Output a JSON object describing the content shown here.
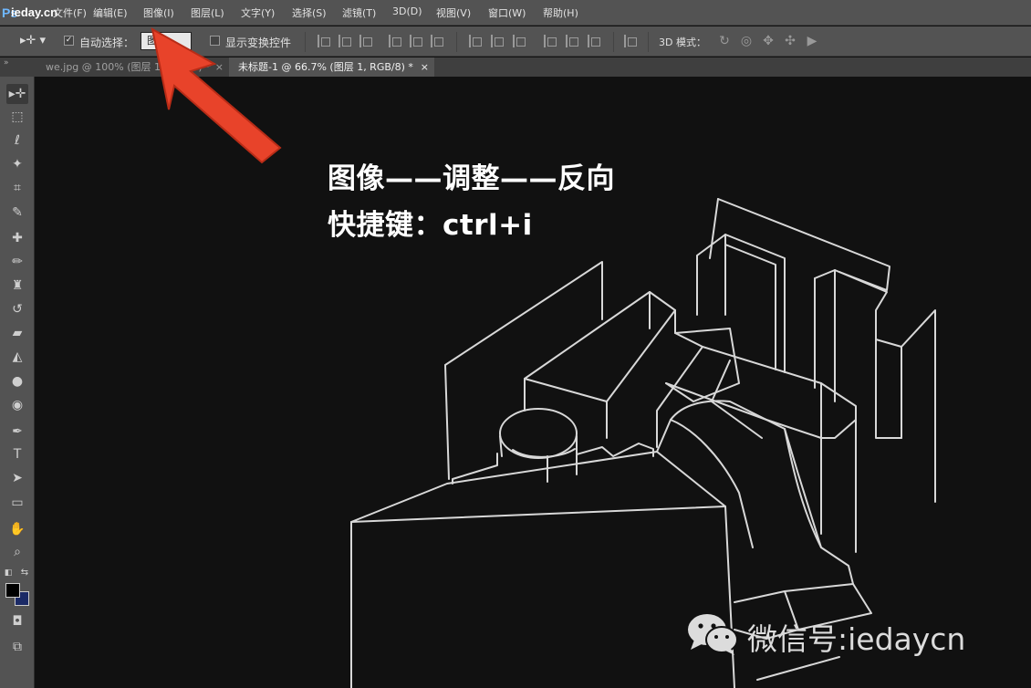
{
  "app": {
    "logo_ps": "Ps",
    "logo_site": "ieday.cn"
  },
  "menu": {
    "items": [
      "文件(F)",
      "编辑(E)",
      "图像(I)",
      "图层(L)",
      "文字(Y)",
      "选择(S)",
      "滤镜(T)",
      "3D(D)",
      "视图(V)",
      "窗口(W)",
      "帮助(H)"
    ]
  },
  "options": {
    "auto_select_label": "自动选择：",
    "auto_select_checked": true,
    "target_value": "图层",
    "show_transform_label": "显示变换控件",
    "show_transform_checked": false,
    "mode_3d_label": "3D 模式："
  },
  "tabs": [
    {
      "label": "we.jpg @ 100% (图层 1, RGB/8) *",
      "active": false
    },
    {
      "label": "未标题-1 @ 66.7% (图层 1, RGB/8) *",
      "active": true
    }
  ],
  "caption": {
    "line1": "图像——调整——反向",
    "line2": "快捷键：ctrl+i"
  },
  "watermark": {
    "text": "微信号:iedaycn"
  },
  "colors": {
    "arrow": "#e8432a",
    "foreground": "#000000",
    "background": "#1b2a66",
    "canvas": "#111111"
  },
  "tools": [
    "move-tool",
    "marquee-tool",
    "lasso-tool",
    "magic-wand-tool",
    "crop-tool",
    "eyedropper-tool",
    "healing-brush-tool",
    "brush-tool",
    "clone-stamp-tool",
    "history-brush-tool",
    "eraser-tool",
    "paint-bucket-tool",
    "blur-tool",
    "dodge-tool",
    "pen-tool",
    "type-tool",
    "path-selection-tool",
    "rectangle-tool",
    "hand-tool",
    "zoom-tool"
  ]
}
